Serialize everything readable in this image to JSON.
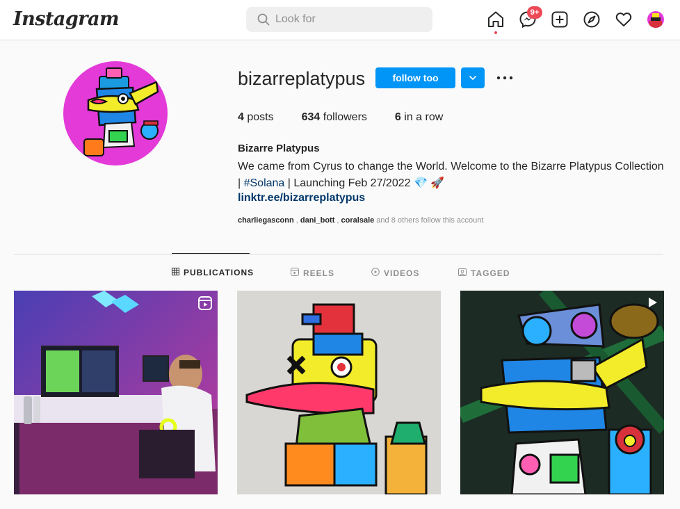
{
  "header": {
    "logo": "Instagram",
    "search_placeholder": "Look for",
    "messenger_badge": "9+"
  },
  "profile": {
    "username": "bizarreplatypus",
    "follow_label": "follow too",
    "stats": {
      "posts_count": "4",
      "posts_label": "posts",
      "followers_count": "634",
      "followers_label": "followers",
      "following_count": "6",
      "following_label": "in a row"
    },
    "full_name": "Bizarre Platypus",
    "bio_line1": "We came from Cyrus to change the World. Welcome to the Bizarre Platypus Collection",
    "bio_prefix": "| ",
    "bio_hashtag": "#Solana",
    "bio_suffix": " | Launching Feb 27/2022 💎 🚀",
    "link": "linktr.ee/bizarreplatypus",
    "followed_by": [
      "charliegasconn",
      "dani_bott",
      "coralsale"
    ],
    "followed_by_sep": " , ",
    "followed_by_rest": " and 8 others follow this account"
  },
  "tabs": [
    {
      "label": "PUBLICATIONS",
      "icon": "grid-icon",
      "active": true
    },
    {
      "label": "REELS",
      "icon": "reels-icon",
      "active": false
    },
    {
      "label": "VIDEOS",
      "icon": "play-circle-icon",
      "active": false
    },
    {
      "label": "TAGGED",
      "icon": "tagged-icon",
      "active": false
    }
  ],
  "posts": [
    {
      "type": "reel",
      "icon": "reels-icon"
    },
    {
      "type": "image"
    },
    {
      "type": "video",
      "icon": "play-icon"
    }
  ],
  "colors": {
    "accent": "#0095f6",
    "badge": "#ed4956",
    "link": "#00376b",
    "avatar_bg": "#e33ad8"
  }
}
